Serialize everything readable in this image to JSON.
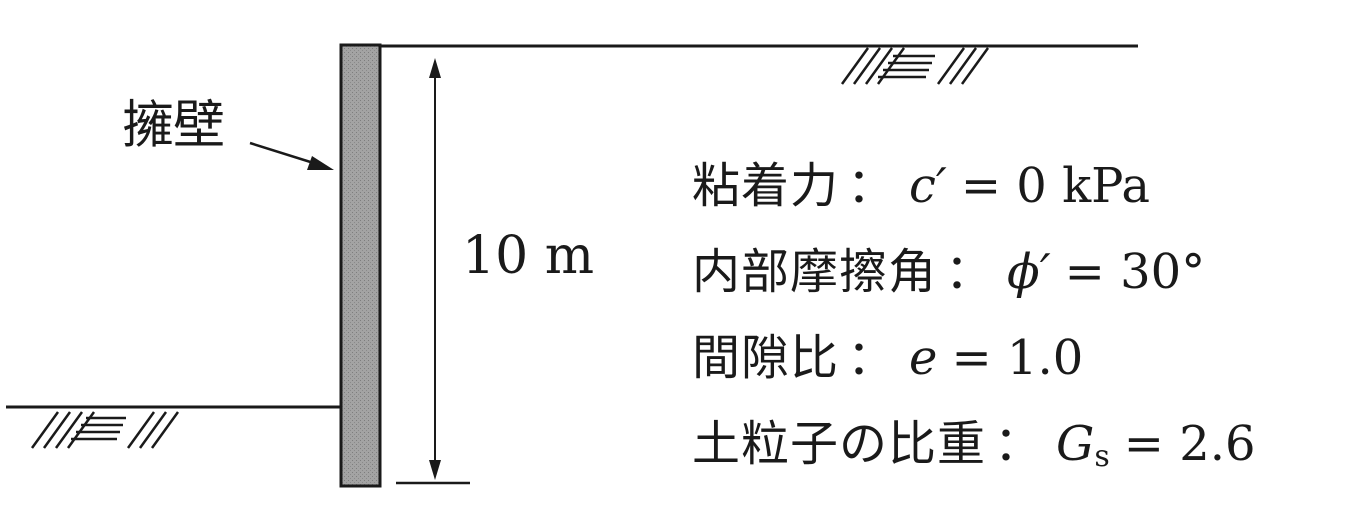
{
  "diagram": {
    "wall_label": "擁壁",
    "height_label": "10 m",
    "colors": {
      "line": "#1a1a1a",
      "wall_fill": "#9a9a9a",
      "background": "#ffffff"
    },
    "properties": [
      {
        "label": "粘着力",
        "separator": "：",
        "symbol": "c′",
        "subscript": "",
        "equals": "= 0 kPa"
      },
      {
        "label": "内部摩擦角",
        "separator": "：",
        "symbol": "ϕ′",
        "subscript": "",
        "equals": "= 30°"
      },
      {
        "label": "間隙比",
        "separator": "：",
        "symbol": "e",
        "subscript": "",
        "equals": "= 1.0"
      },
      {
        "label": "土粒子の比重",
        "separator": "：",
        "symbol": "G",
        "subscript": "s",
        "equals": "= 2.6"
      }
    ]
  }
}
